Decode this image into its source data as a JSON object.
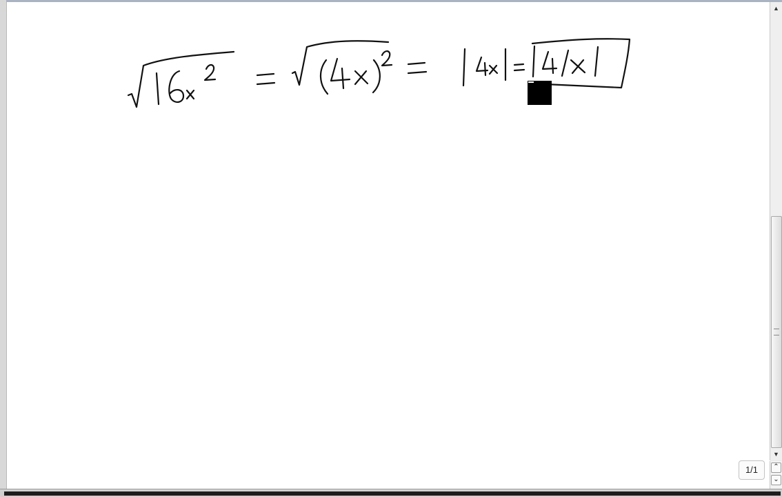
{
  "canvas": {
    "expression_description_free": true,
    "ink_color": "#111111"
  },
  "scrollbar": {
    "up_arrow_icon": "triangle-up-icon",
    "down_arrow_icon": "triangle-down-icon"
  },
  "page_indicator": {
    "text": "1/1"
  },
  "page_nav": {
    "prev_icon": "double-chevron-up-icon",
    "next_icon": "double-chevron-down-icon",
    "prev_glyph": "⌃",
    "next_glyph": "⌄"
  },
  "colors": {
    "window_bg": "#e9e9e9",
    "canvas_bg": "#ffffff",
    "cursor": "#000000"
  }
}
